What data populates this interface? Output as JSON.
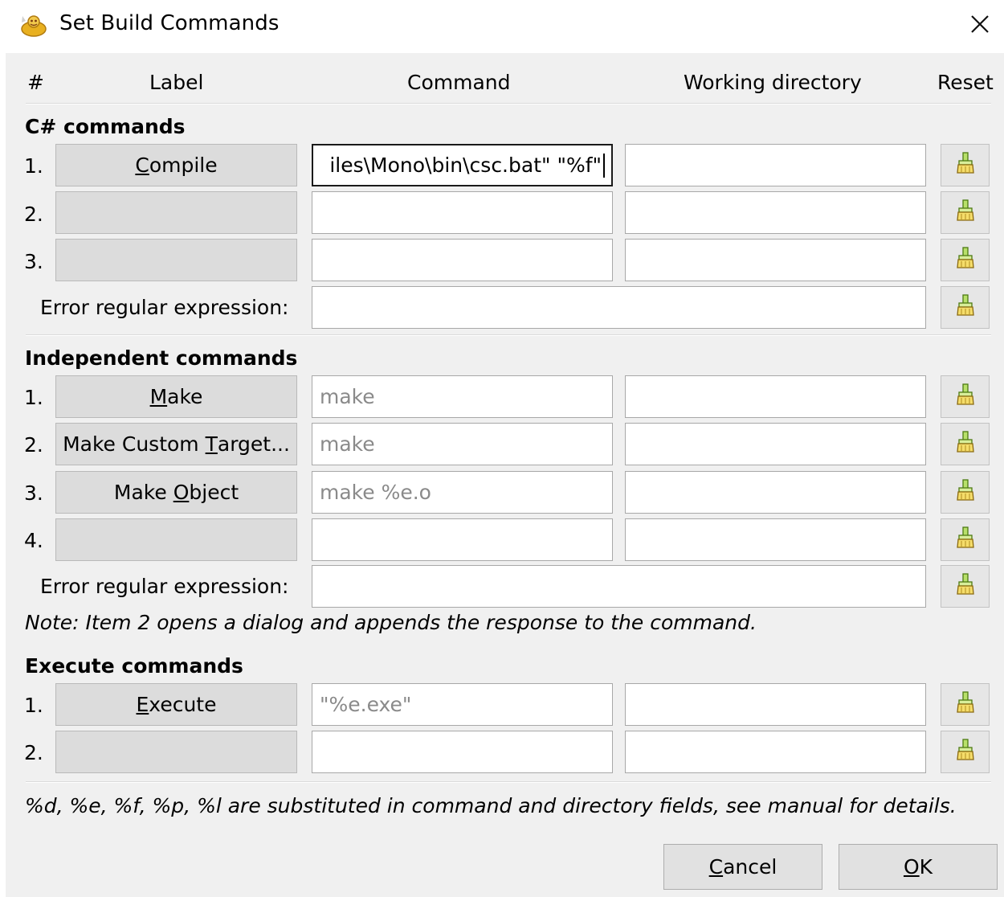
{
  "window": {
    "title": "Set Build Commands",
    "app_icon": "geany-genie-icon",
    "close_glyph": "✕"
  },
  "headers": {
    "num": "#",
    "label": "Label",
    "command": "Command",
    "workdir": "Working directory",
    "reset": "Reset"
  },
  "sections": [
    {
      "title": "C# commands",
      "rows": [
        {
          "num": "1.",
          "label_pre": "",
          "label_key": "C",
          "label_post": "ompile",
          "command": "iles\\Mono\\bin\\csc.bat\" \"%f\"",
          "command_is_placeholder": false,
          "focused": true,
          "workdir": ""
        },
        {
          "num": "2.",
          "label_pre": "",
          "label_key": "",
          "label_post": "",
          "command": "",
          "workdir": ""
        },
        {
          "num": "3.",
          "label_pre": "",
          "label_key": "",
          "label_post": "",
          "command": "",
          "workdir": ""
        }
      ],
      "error_regex_label": "Error regular expression:",
      "error_regex": ""
    },
    {
      "title": "Independent commands",
      "rows": [
        {
          "num": "1.",
          "label_pre": "",
          "label_key": "M",
          "label_post": "ake",
          "command": "make",
          "command_is_placeholder": true,
          "workdir": ""
        },
        {
          "num": "2.",
          "label_pre": "Make Custom ",
          "label_key": "T",
          "label_post": "arget...",
          "command": "make",
          "command_is_placeholder": true,
          "workdir": ""
        },
        {
          "num": "3.",
          "label_pre": "Make ",
          "label_key": "O",
          "label_post": "bject",
          "command": "make %e.o",
          "command_is_placeholder": true,
          "workdir": ""
        },
        {
          "num": "4.",
          "label_pre": "",
          "label_key": "",
          "label_post": "",
          "command": "",
          "workdir": ""
        }
      ],
      "error_regex_label": "Error regular expression:",
      "error_regex": "",
      "note": "Note: Item 2 opens a dialog and appends the response to the command."
    },
    {
      "title": "Execute commands",
      "rows": [
        {
          "num": "1.",
          "label_pre": "",
          "label_key": "E",
          "label_post": "xecute",
          "command": "\"%e.exe\"",
          "command_is_placeholder": true,
          "workdir": ""
        },
        {
          "num": "2.",
          "label_pre": "",
          "label_key": "",
          "label_post": "",
          "command": "",
          "workdir": ""
        }
      ]
    }
  ],
  "footer_note": "%d, %e, %f, %p, %l are substituted in command and directory fields, see manual for details.",
  "buttons": {
    "cancel_key": "C",
    "cancel_rest": "ancel",
    "ok_key": "O",
    "ok_rest": "K"
  },
  "reset_icon": "clear-broom-icon",
  "colors": {
    "dialog_bg": "#f0f0f0",
    "button_bg": "#dcdcdc",
    "field_border": "#a8a8a8",
    "placeholder_text": "#8a8a8a"
  }
}
